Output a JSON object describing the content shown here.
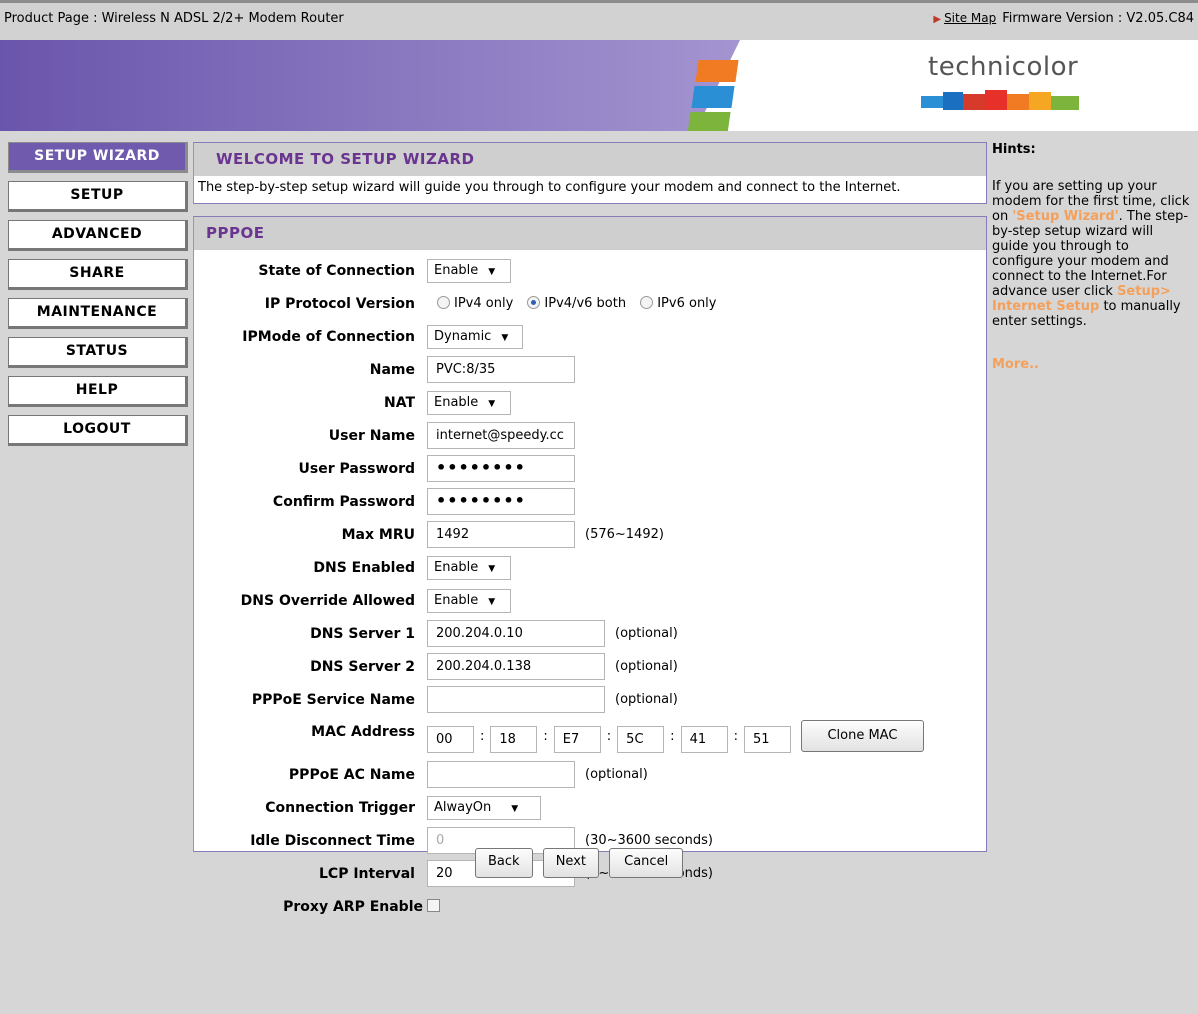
{
  "topbar": {
    "product": "Product Page : Wireless N ADSL 2/2+ Modem Router",
    "site_map": "Site Map",
    "firmware": "Firmware Version : V2.05.C84"
  },
  "banner": {
    "brand": "technicolor"
  },
  "nav": {
    "items": [
      "SETUP WIZARD",
      "SETUP",
      "ADVANCED",
      "SHARE",
      "MAINTENANCE",
      "STATUS",
      "HELP",
      "LOGOUT"
    ],
    "active": "SETUP WIZARD"
  },
  "welcome": {
    "title": "WELCOME TO SETUP WIZARD",
    "text": "The step-by-step setup wizard will guide you through to configure your modem and connect to the Internet."
  },
  "pppoe": {
    "title": "PPPOE",
    "labels": {
      "state": "State of Connection",
      "ip_protocol": "IP Protocol Version",
      "ipmode": "IPMode of Connection",
      "name": "Name",
      "nat": "NAT",
      "username": "User Name",
      "password": "User Password",
      "confirm": "Confirm Password",
      "mru": "Max MRU",
      "dns_enabled": "DNS Enabled",
      "dns_override": "DNS Override Allowed",
      "dns1": "DNS Server 1",
      "dns2": "DNS Server 2",
      "service": "PPPoE Service Name",
      "mac": "MAC Address",
      "ac_name": "PPPoE AC Name",
      "trigger": "Connection Trigger",
      "idle": "Idle Disconnect Time",
      "lcp": "LCP Interval",
      "proxy_arp": "Proxy ARP Enable"
    },
    "values": {
      "state": "Enable",
      "ip_options": [
        "IPv4 only",
        "IPv4/v6 both",
        "IPv6 only"
      ],
      "ip_selected": "IPv4/v6 both",
      "ipmode": "Dynamic",
      "name": "PVC:8/35",
      "nat": "Enable",
      "username": "internet@speedy.cc",
      "password": "••••••••",
      "confirm": "••••••••",
      "mru": "1492",
      "mru_hint": "(576~1492)",
      "dns_enabled": "Enable",
      "dns_override": "Enable",
      "dns1": "200.204.0.10",
      "dns2": "200.204.0.138",
      "service": "",
      "optional": "(optional)",
      "mac": [
        "00",
        "18",
        "E7",
        "5C",
        "41",
        "51"
      ],
      "clone_mac": "Clone MAC",
      "ac_name": "",
      "trigger": "AlwayOn",
      "idle": "0",
      "idle_hint": "(30~3600 seconds)",
      "lcp": "20",
      "lcp_hint": "(0~86400 seconds)",
      "proxy_arp": false
    }
  },
  "actions": {
    "back": "Back",
    "next": "Next",
    "cancel": "Cancel"
  },
  "hints": {
    "title": "Hints:",
    "p1": "If you are setting up your modem for the first time, click on ",
    "hl1": "'Setup Wizard'",
    "p2": ". The step-by-step setup wizard will guide you through to configure your modem and connect to the Internet.For advance user click ",
    "hl2": "Setup> Internet Setup",
    "p3": " to manually enter settings.",
    "more": "More.."
  },
  "colors": {
    "accent": "#6f5aae",
    "title": "#6a3590",
    "hint_link": "#f5a05a"
  }
}
